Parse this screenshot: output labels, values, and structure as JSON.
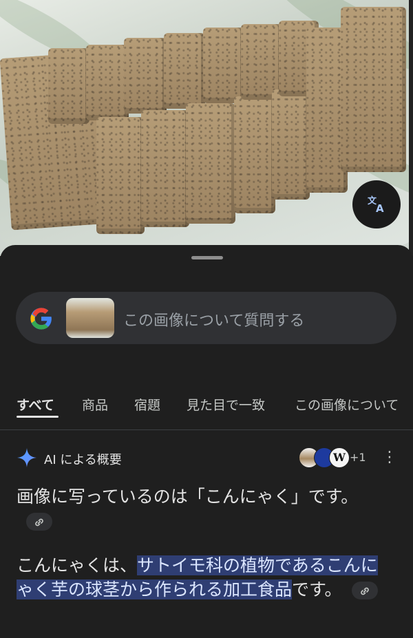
{
  "translate_icon": "translate-icon",
  "search": {
    "placeholder": "この画像について質問する",
    "logo_icon": "google-g-icon"
  },
  "tabs": [
    {
      "label": "すべて",
      "active": true
    },
    {
      "label": "商品",
      "active": false
    },
    {
      "label": "宿題",
      "active": false
    },
    {
      "label": "見た目で一致",
      "active": false
    },
    {
      "label": "この画像について",
      "active": false
    }
  ],
  "ai_overview": {
    "title": "AI による概要",
    "more_sources": "+1",
    "menu_icon": "more-vert-icon"
  },
  "answer": {
    "p1": "画像に写っているのは「こんにゃく」です。",
    "p2_lead": "こんにゃくは、",
    "p2_highlight": "サトイモ科の植物であるこんにゃく芋の球茎から作られる加工食品",
    "p2_tail": "です。"
  },
  "colors": {
    "background": "#1f1f1f",
    "search_bg": "#303134",
    "highlight": "#2f3e73",
    "accent": "#a8c7fa"
  }
}
